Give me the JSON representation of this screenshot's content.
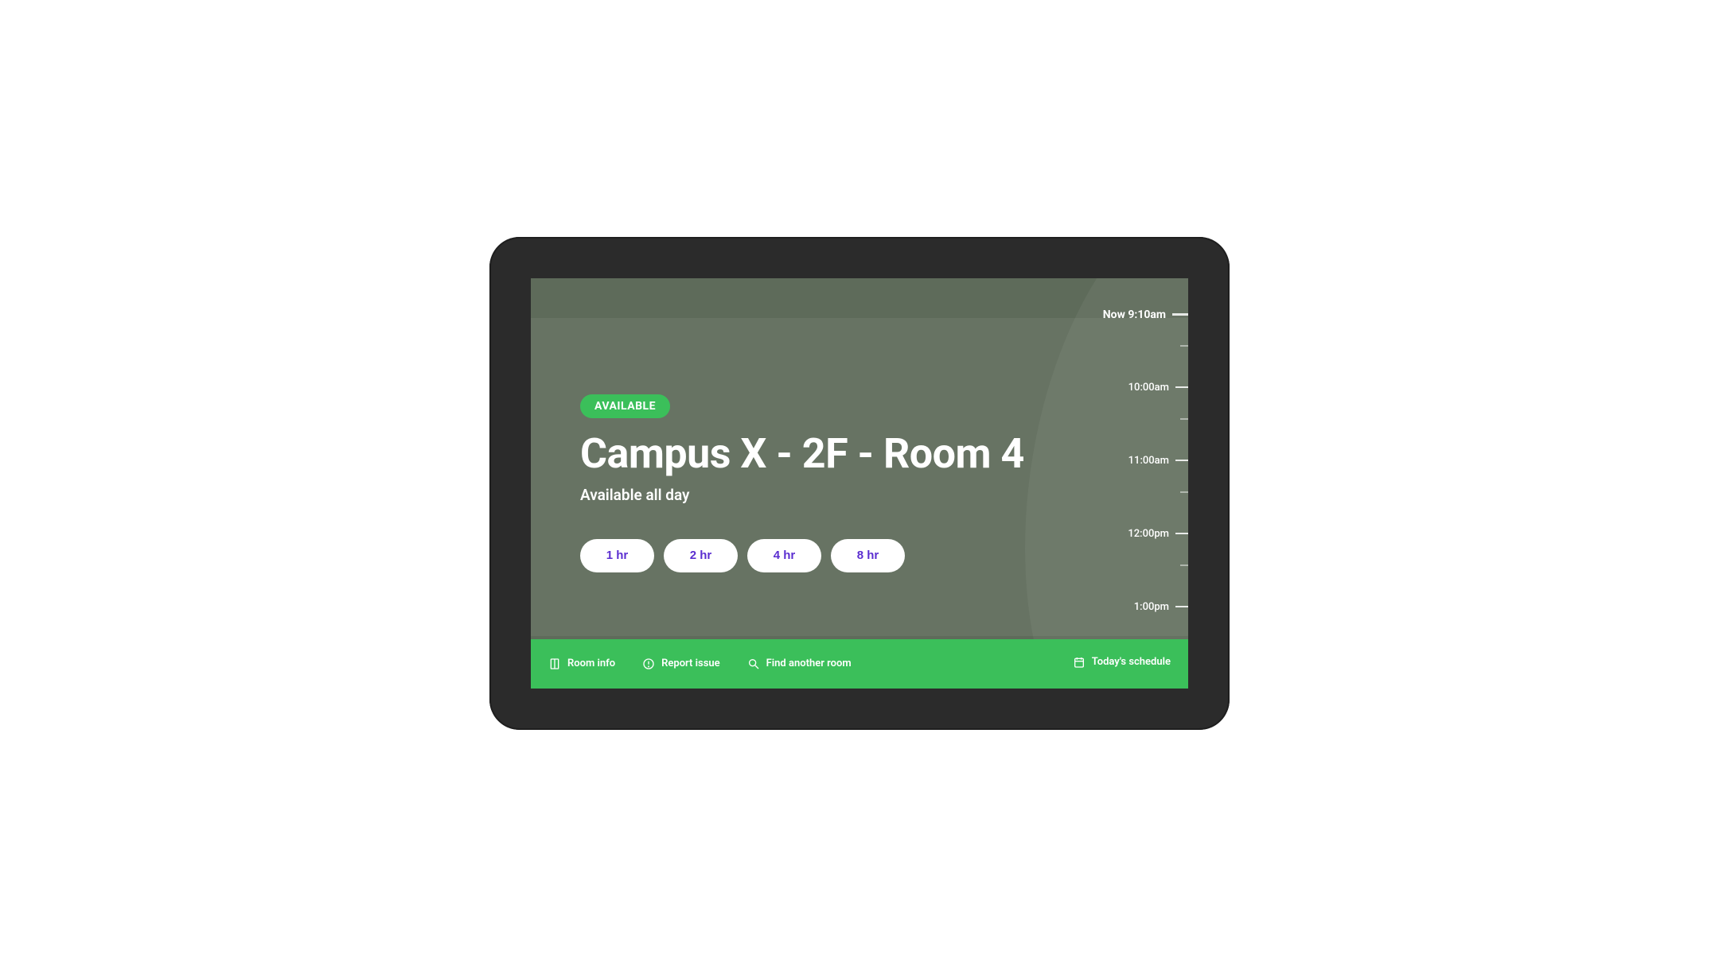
{
  "status": {
    "badge_label": "AVAILABLE",
    "room_name": "Campus X - 2F - Room 4",
    "availability_text": "Available all day"
  },
  "durations": [
    {
      "label": "1 hr"
    },
    {
      "label": "2 hr"
    },
    {
      "label": "4 hr"
    },
    {
      "label": "8 hr"
    }
  ],
  "timeline": {
    "now_label": "Now 9:10am",
    "hours": [
      "10:00am",
      "11:00am",
      "12:00pm",
      "1:00pm"
    ]
  },
  "bottom_bar": {
    "room_info": "Room info",
    "report_issue": "Report issue",
    "find_room": "Find another room",
    "schedule": "Today's schedule"
  },
  "colors": {
    "accent_green": "#3bbf5a",
    "bg_olive": "#5e6b5a",
    "button_text_purple": "#5b2ed0"
  }
}
